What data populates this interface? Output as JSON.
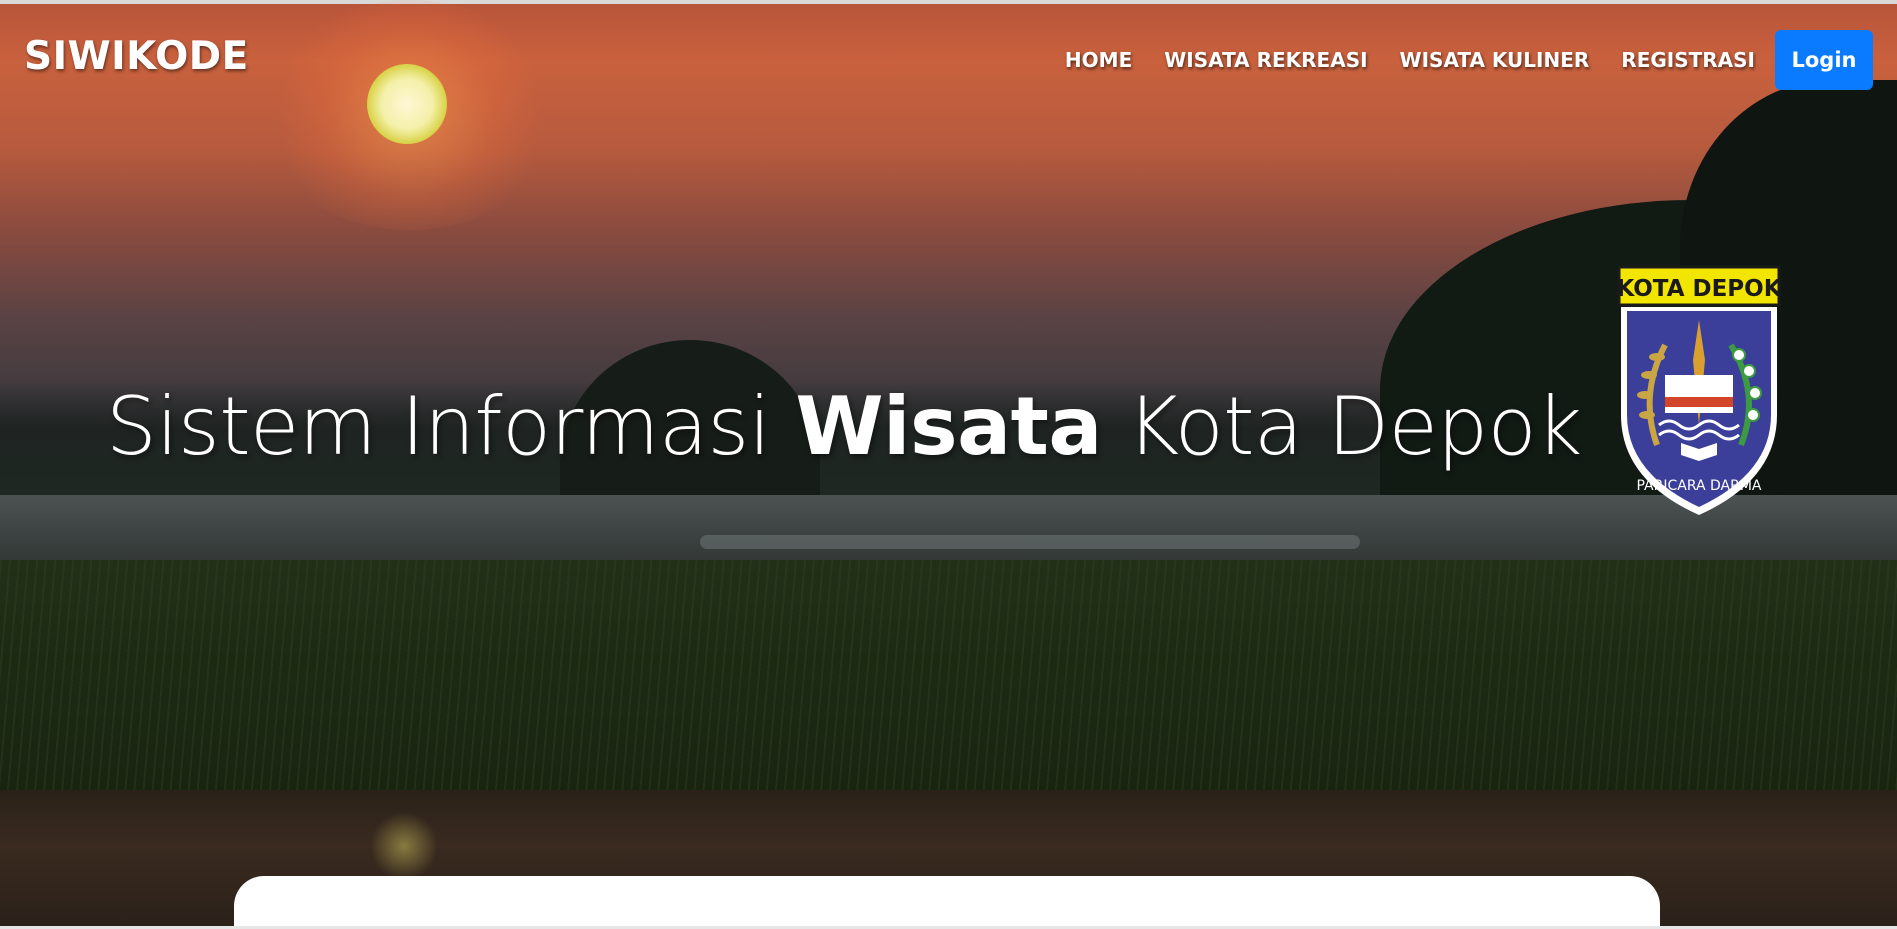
{
  "navbar": {
    "brand": "SIWIKODE",
    "links": [
      {
        "label": "HOME"
      },
      {
        "label": "WISATA REKREASI"
      },
      {
        "label": "WISATA KULINER"
      },
      {
        "label": "REGISTRASI"
      }
    ],
    "login_label": "Login"
  },
  "hero": {
    "title_part1": "Sistem Informasi ",
    "title_bold": "Wisata",
    "title_part2": " Kota Depok"
  },
  "emblem": {
    "top_text": "KOTA DEPOK",
    "bottom_text": "PARICARA DARMA"
  },
  "colors": {
    "login_button": "#0a7bff",
    "emblem_banner": "#f2e500",
    "emblem_shield": "#3b3f9a"
  }
}
